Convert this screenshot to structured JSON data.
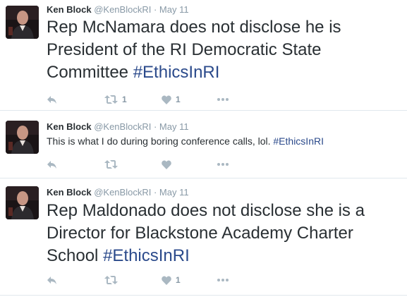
{
  "tweets": [
    {
      "name": "Ken Block",
      "handle": "@KenBlockRI",
      "dot": "·",
      "time": "May 11",
      "text_main": "Rep McNamara does not disclose he is President of the RI Democratic State Committee ",
      "hashtag": "#EthicsInRI",
      "retweet_count": "1",
      "like_count": "1"
    },
    {
      "name": "Ken Block",
      "handle": "@KenBlockRI",
      "dot": "·",
      "time": "May 11",
      "text_main": "This is what I do during boring conference calls, lol. ",
      "hashtag": "#EthicsInRI",
      "retweet_count": "",
      "like_count": ""
    },
    {
      "name": "Ken Block",
      "handle": "@KenBlockRI",
      "dot": "·",
      "time": "May 11",
      "text_main": "Rep Maldonado does not disclose she is a Director for Blackstone Academy Charter School ",
      "hashtag": "#EthicsInRI",
      "retweet_count": "",
      "like_count": "1"
    }
  ],
  "colors": {
    "hashtag": "#2b4a8b",
    "muted": "#8899a6",
    "divider": "#e1e8ed"
  },
  "icons": [
    "reply-icon",
    "retweet-icon",
    "like-icon",
    "more-icon"
  ]
}
